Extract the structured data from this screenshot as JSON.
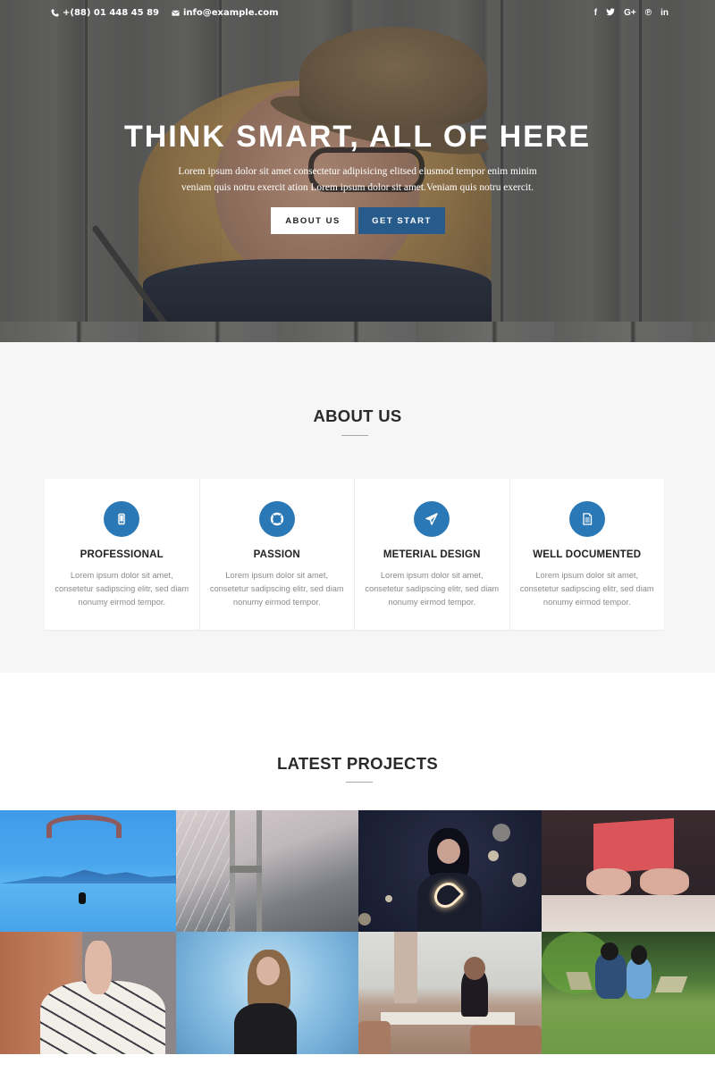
{
  "topbar": {
    "phone": "+(88) 01 448 45 89",
    "email": "info@example.com",
    "phone_icon": "phone-icon",
    "email_icon": "envelope-icon",
    "socials": [
      {
        "name": "facebook",
        "glyph": "f"
      },
      {
        "name": "twitter",
        "glyph": "🐦"
      },
      {
        "name": "google-plus",
        "glyph": "G+"
      },
      {
        "name": "pinterest",
        "glyph": "℗"
      },
      {
        "name": "linkedin",
        "glyph": "in"
      }
    ]
  },
  "hero": {
    "title": "THINK SMART, ALL OF HERE",
    "subtitle": "Lorem ipsum dolor sit amet consectetur adipisicing elitsed eiusmod tempor enim minim veniam quis notru exercit ation Lorem ipsum dolor sit amet.Veniam quis notru exercit.",
    "buttons": {
      "about": "ABOUT US",
      "start": "GET START"
    }
  },
  "about": {
    "title": "ABOUT US",
    "cards": [
      {
        "icon": "mobile-icon",
        "title": "PROFESSIONAL",
        "text": "Lorem ipsum dolor sit amet, consetetur sadipscing elitr, sed diam nonumy eirmod tempor."
      },
      {
        "icon": "lifebuoy-icon",
        "title": "PASSION",
        "text": "Lorem ipsum dolor sit amet, consetetur sadipscing elitr, sed diam nonumy eirmod tempor."
      },
      {
        "icon": "paper-plane-icon",
        "title": "METERIAL DESIGN",
        "text": "Lorem ipsum dolor sit amet, consetetur sadipscing elitr, sed diam nonumy eirmod tempor."
      },
      {
        "icon": "document-icon",
        "title": "WELL DOCUMENTED",
        "text": "Lorem ipsum dolor sit amet, consetetur sadipscing elitr, sed diam nonumy eirmod tempor."
      }
    ]
  },
  "projects": {
    "title": "LATEST PROJECTS",
    "items": [
      {
        "subject": "paraglider-over-mountains"
      },
      {
        "subject": "suspension-bridge-in-fog"
      },
      {
        "subject": "woman-with-light-heart"
      },
      {
        "subject": "hands-reading-red-book"
      },
      {
        "subject": "hand-holding-plaid-coat"
      },
      {
        "subject": "woman-in-blue-smoke"
      },
      {
        "subject": "woman-reading-in-library"
      },
      {
        "subject": "couple-with-laptops-on-grass"
      }
    ]
  },
  "colors": {
    "accent": "#2a78b6",
    "button_dark": "#275b8c",
    "section_bg": "#f6f6f6"
  }
}
